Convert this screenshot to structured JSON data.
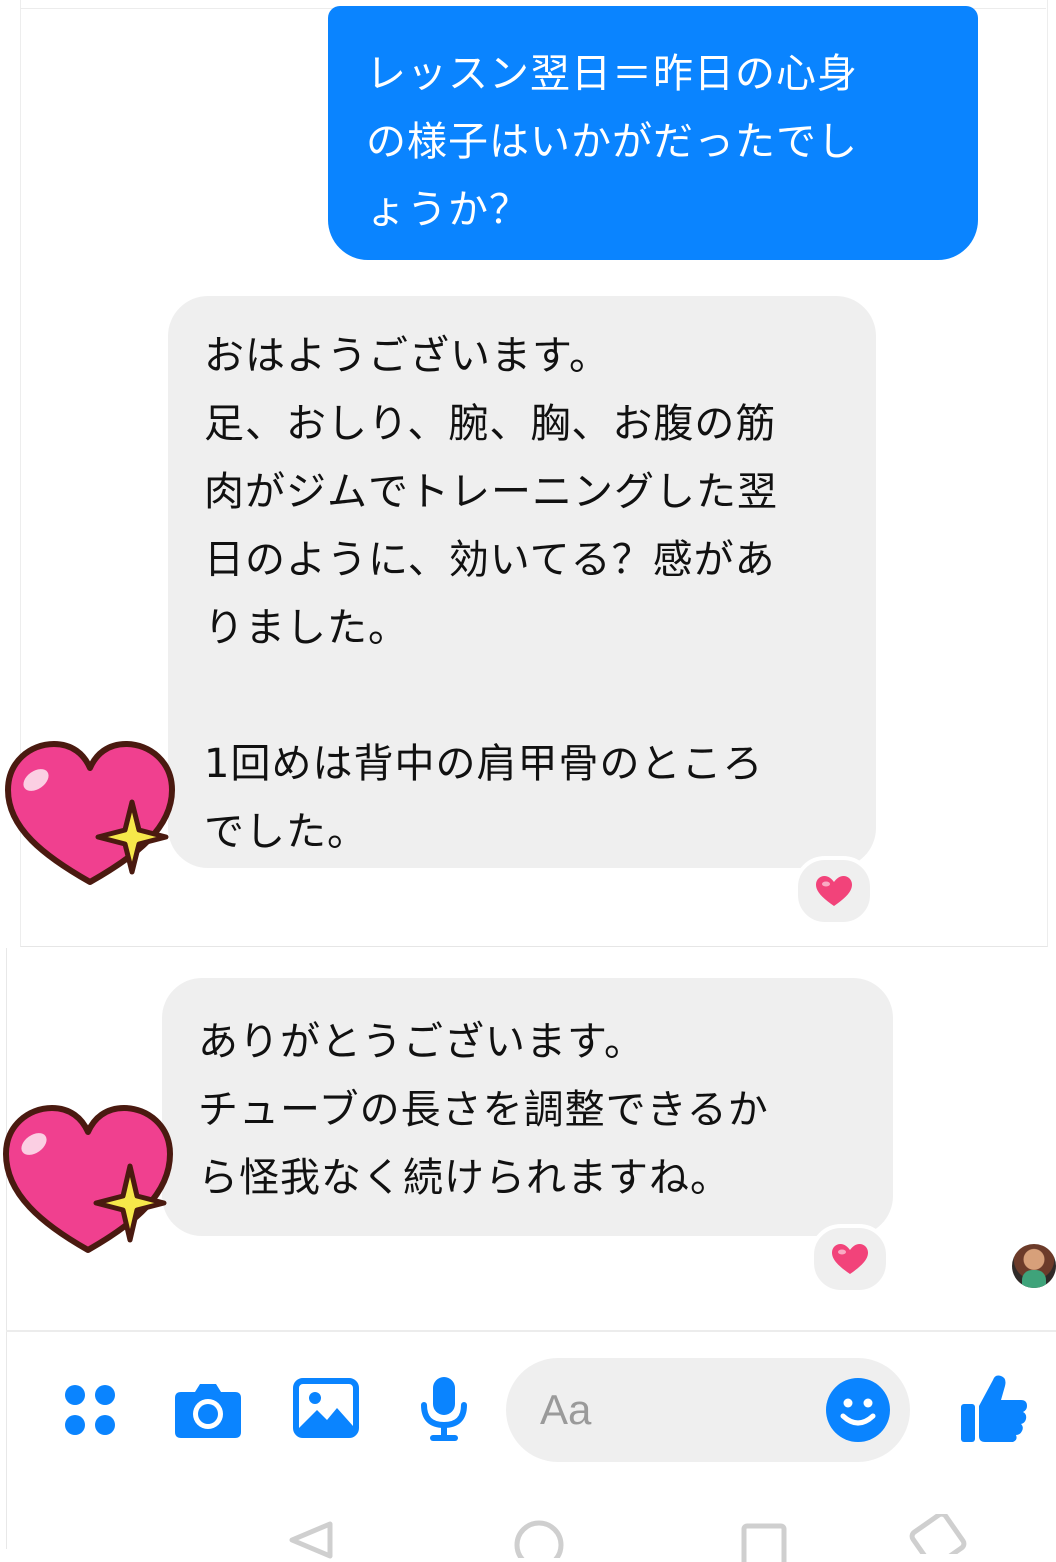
{
  "messages": [
    {
      "direction": "outgoing",
      "text": "レッスン翌日＝昨日の心身\nの様子はいかがだったでし\nょうか？"
    },
    {
      "direction": "incoming",
      "text": "おはようございます。\n足、おしり、腕、胸、お腹の筋\n肉がジムでトレーニングした翌\n日のように、効いてる？感があ\nりました。\n\n1回めは背中の肩甲骨のところ\nでした。",
      "reaction": "heart"
    },
    {
      "direction": "incoming",
      "text": "ありがとうございます。\nチューブの長さを調整できるか\nら怪我なく続けられますね。",
      "reaction": "heart"
    }
  ],
  "composer": {
    "placeholder": "Aa",
    "icons": [
      "apps-icon",
      "camera-icon",
      "image-icon",
      "microphone-icon",
      "emoji-icon",
      "thumbs-up-icon"
    ]
  },
  "stickers": [
    "heart-sparkle-sticker",
    "heart-sparkle-sticker"
  ],
  "navbar": {
    "icons": [
      "back-icon",
      "home-icon",
      "recents-icon",
      "rotate-icon"
    ]
  },
  "colors": {
    "outgoing_bubble": "#0a84ff",
    "incoming_bubble": "#efefef",
    "accent": "#0a84ff",
    "reaction_heart": "#f2437a",
    "sticker_heart": "#f0408f"
  }
}
